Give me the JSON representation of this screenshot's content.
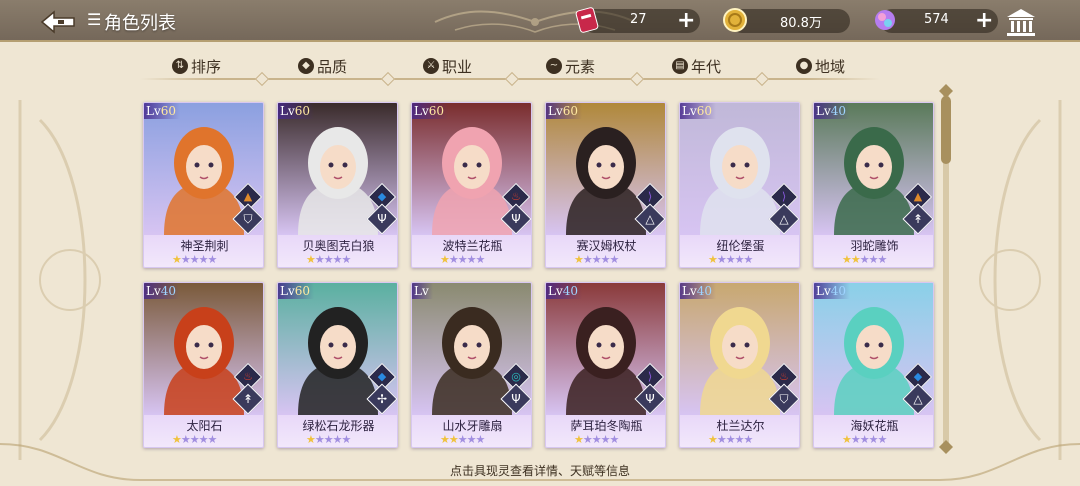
{
  "header": {
    "title": "角色列表",
    "resources": [
      {
        "name": "ticket",
        "value": "27",
        "has_plus": true,
        "color": "#c8284a"
      },
      {
        "name": "coin",
        "value": "80.8万",
        "has_plus": false,
        "color": "#e2b23a"
      },
      {
        "name": "gem",
        "value": "574",
        "has_plus": true,
        "color": "#b67df0"
      }
    ]
  },
  "filters": [
    {
      "label": "排序",
      "icon": "sort-icon"
    },
    {
      "label": "品质",
      "icon": "quality-icon"
    },
    {
      "label": "职业",
      "icon": "class-icon"
    },
    {
      "label": "元素",
      "icon": "element-icon"
    },
    {
      "label": "年代",
      "icon": "era-icon"
    },
    {
      "label": "地域",
      "icon": "region-icon"
    }
  ],
  "cards": [
    {
      "lv_prefix": "Lv",
      "lv": "60",
      "name": "神圣荆刺",
      "stars": 1,
      "element": "earth",
      "cls": "shield",
      "hair": "#e0742c",
      "bg": "#8ba0e0"
    },
    {
      "lv_prefix": "Lv",
      "lv": "60",
      "name": "贝奥图克白狼",
      "stars": 1,
      "element": "water",
      "cls": "fork",
      "hair": "#e8e8e8",
      "bg": "#3a2b2b"
    },
    {
      "lv_prefix": "Lv",
      "lv": "60",
      "name": "波特兰花瓶",
      "stars": 1,
      "element": "fire",
      "cls": "fork",
      "hair": "#f0a3b0",
      "bg": "#7a2d2d"
    },
    {
      "lv_prefix": "Lv",
      "lv": "60",
      "name": "赛汉姆权杖",
      "stars": 1,
      "element": "wind",
      "cls": "prism",
      "hair": "#2a2020",
      "bg": "#b0883a"
    },
    {
      "lv_prefix": "Lv",
      "lv": "60",
      "name": "纽伦堡蛋",
      "stars": 1,
      "element": "wind",
      "cls": "prism",
      "hair": "#dfe2ee",
      "bg": "#c0b8d8"
    },
    {
      "lv_prefix": "Lv",
      "lv": "40",
      "name": "羽蛇雕饰",
      "stars": 2,
      "element": "earth",
      "cls": "arrow",
      "hair": "#3a6a4a",
      "bg": "#5a7a5a"
    },
    {
      "lv_prefix": "Lv",
      "lv": "40",
      "name": "太阳石",
      "stars": 1,
      "element": "fire",
      "cls": "arrow",
      "hair": "#c8401a",
      "bg": "#7a5a3a"
    },
    {
      "lv_prefix": "Lv",
      "lv": "60",
      "name": "绿松石龙形器",
      "stars": 1,
      "element": "water",
      "cls": "cross",
      "hair": "#222222",
      "bg": "#5ab0a0"
    },
    {
      "lv_prefix": "Lv",
      "lv": "",
      "name": "山水牙雕扇",
      "stars": 2,
      "element": "swirl",
      "cls": "fork",
      "hair": "#3a2b20",
      "bg": "#8a8a70"
    },
    {
      "lv_prefix": "Lv",
      "lv": "40",
      "name": "萨耳珀冬陶瓶",
      "stars": 1,
      "element": "wind",
      "cls": "fork",
      "hair": "#3a2020",
      "bg": "#8a3a3a"
    },
    {
      "lv_prefix": "Lv",
      "lv": "40",
      "name": "杜兰达尔",
      "stars": 1,
      "element": "fire",
      "cls": "shield",
      "hair": "#f0d890",
      "bg": "#c8a870"
    },
    {
      "lv_prefix": "Lv",
      "lv": "40",
      "name": "海妖花瓶",
      "stars": 1,
      "element": "water",
      "cls": "prism",
      "hair": "#5ad0c0",
      "bg": "#8ad0e8"
    }
  ],
  "hint": "点击具现灵查看详情、天赋等信息"
}
